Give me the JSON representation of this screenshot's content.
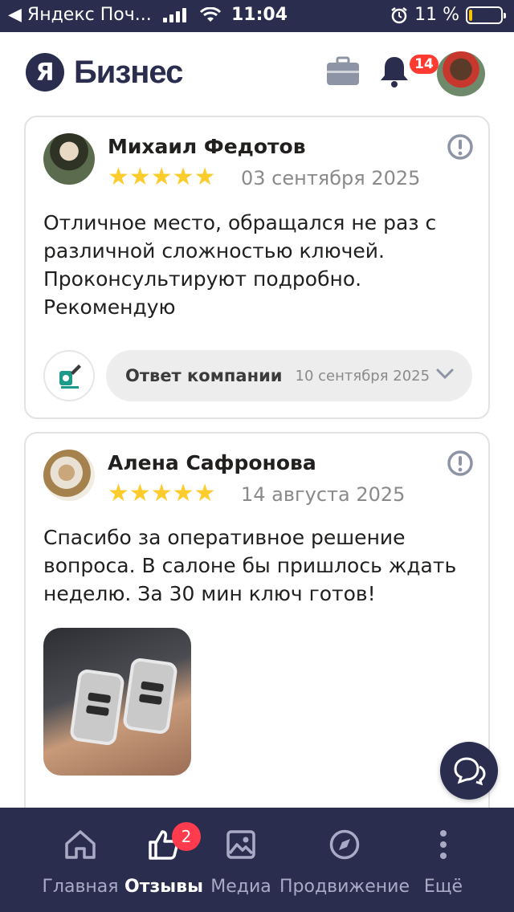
{
  "status_bar": {
    "carrier": "◀ Яндекс Поч...",
    "time": "11:04",
    "battery_percent": "11 %",
    "battery_level": 0.11
  },
  "header": {
    "logo_letter": "Я",
    "logo_text": "Бизнес",
    "notifications_count": "14"
  },
  "reviews": [
    {
      "author": "Михаил Федотов",
      "rating": 5,
      "stars": "★★★★★",
      "date": "03 сентября 2025",
      "text": "Отличное место, обращался не раз с различной сложностью ключей. Проконсультируют подробно. Рекомендую",
      "reply_label": "Ответ компании",
      "reply_date": "10 сентября 2025"
    },
    {
      "author": "Алена Сафронова",
      "rating": 5,
      "stars": "★★★★★",
      "date": "14 августа 2025",
      "text": "Спасибо за оперативное решение вопроса. В салоне бы пришлось ждать неделю. За 30 мин ключ готов!"
    }
  ],
  "bottom_nav": {
    "items": [
      {
        "label": "Главная",
        "icon": "home-icon"
      },
      {
        "label": "Отзывы",
        "icon": "thumbs-up-icon",
        "badge": "2",
        "active": true
      },
      {
        "label": "Медиа",
        "icon": "image-icon"
      },
      {
        "label": "Продвижение",
        "icon": "compass-icon"
      },
      {
        "label": "Ещё",
        "icon": "more-vertical-icon"
      }
    ]
  },
  "colors": {
    "brand_dark": "#2a2d4e",
    "star": "#fccc2c",
    "badge_red": "#ff3b30"
  }
}
